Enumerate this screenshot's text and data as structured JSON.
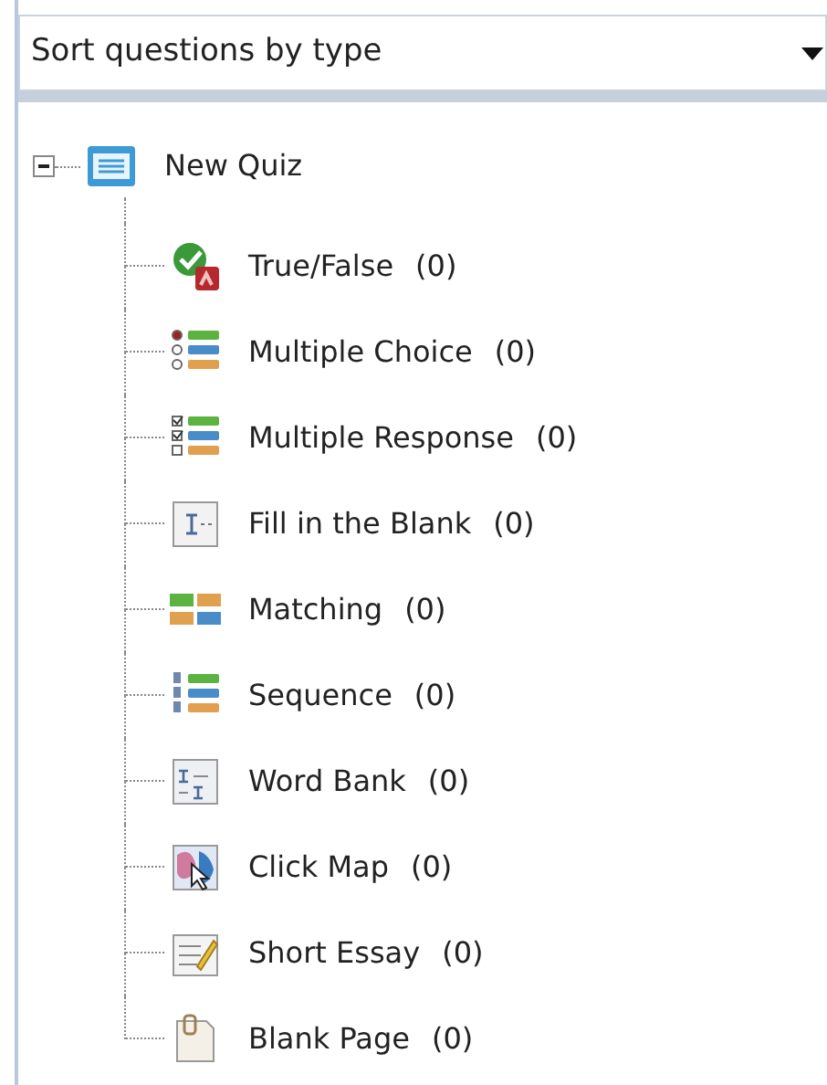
{
  "sort_dropdown": {
    "value": "Sort questions by type"
  },
  "tree": {
    "root": {
      "label": "New Quiz",
      "expanded": true
    },
    "children": [
      {
        "kind": "true-false",
        "label": "True/False",
        "count": "(0)"
      },
      {
        "kind": "multiple-choice",
        "label": "Multiple Choice",
        "count": "(0)"
      },
      {
        "kind": "multiple-response",
        "label": "Multiple Response",
        "count": "(0)"
      },
      {
        "kind": "fill-blank",
        "label": "Fill in the Blank",
        "count": "(0)"
      },
      {
        "kind": "matching",
        "label": "Matching",
        "count": "(0)"
      },
      {
        "kind": "sequence",
        "label": "Sequence",
        "count": "(0)"
      },
      {
        "kind": "word-bank",
        "label": "Word Bank",
        "count": "(0)"
      },
      {
        "kind": "click-map",
        "label": "Click Map",
        "count": "(0)"
      },
      {
        "kind": "short-essay",
        "label": "Short Essay",
        "count": "(0)"
      },
      {
        "kind": "blank-page",
        "label": "Blank Page",
        "count": "(0)"
      }
    ]
  }
}
